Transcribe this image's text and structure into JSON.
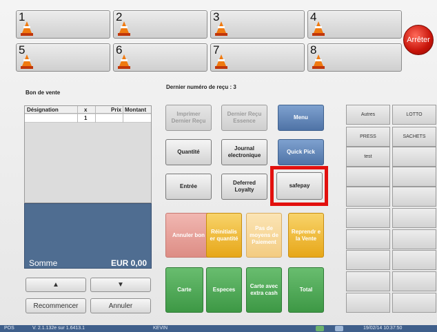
{
  "pumps": [
    {
      "number": "1"
    },
    {
      "number": "2"
    },
    {
      "number": "3"
    },
    {
      "number": "4"
    },
    {
      "number": "5"
    },
    {
      "number": "6"
    },
    {
      "number": "7"
    },
    {
      "number": "8"
    }
  ],
  "stop_button": "Arrêter",
  "sale_title": "Bon de vente",
  "last_receipt": "Dernier numéro de reçu : 3",
  "receipt": {
    "headers": {
      "designation": "Désignation",
      "qty": "x",
      "price": "Prix",
      "amount": "Montant"
    },
    "rows": [
      {
        "designation": "",
        "qty": "1",
        "price": "",
        "amount": ""
      }
    ]
  },
  "total": {
    "label": "Somme",
    "value": "EUR 0,00"
  },
  "nav": {
    "up": "▲",
    "down": "▼",
    "restart": "Recommencer",
    "cancel": "Annuler"
  },
  "functions": {
    "print_last": "Imprimer Dernier Reçu",
    "last_receipt_fuel": "Dernier Reçu Essence",
    "menu": "Menu",
    "quantity": "Quantité",
    "journal": "Journal electronique",
    "quick_pick": "Quick Pick",
    "entry": "Entrée",
    "deferred_loyalty": "Deferred Loyalty",
    "safepay": "safepay",
    "cancel_voucher": "Annuler bon",
    "reset_quantity": "Réinitialis er quantité",
    "no_payment_means": "Pas de moyens de Paiement",
    "resume_sale": "Reprendr e la Vente",
    "card": "Carte",
    "cash": "Especes",
    "card_extra_cash": "Carte avec extra cash",
    "total": "Total"
  },
  "categories": [
    "Autres",
    "LOTTO",
    "PRESS",
    "SACHETS",
    "test",
    "",
    "",
    "",
    "",
    "",
    "",
    "",
    "",
    "",
    "",
    "",
    "",
    "",
    "",
    ""
  ],
  "status": {
    "pos": "POS",
    "version": "V. 2.1.132e sur 1.6413.1",
    "user": "KEVIN",
    "datetime": "19/02/14  10:37:50"
  },
  "colors": {
    "highlight": "#e2100e",
    "total_panel": "#4f6d91",
    "stop": "#c8140a"
  },
  "icons": {
    "pump": "traffic-cone-icon",
    "stop": "stop-button"
  }
}
